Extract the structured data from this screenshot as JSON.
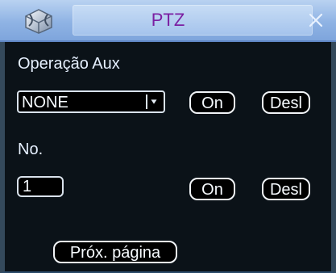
{
  "window": {
    "title": "PTZ",
    "logo_icon": "cube-logo-icon",
    "close_icon": "close-icon"
  },
  "aux": {
    "label": "Operação Aux",
    "select_value": "NONE",
    "on_label": "On",
    "off_label": "Desl"
  },
  "number": {
    "label": "No.",
    "value": "1",
    "on_label": "On",
    "off_label": "Desl"
  },
  "next_page_label": "Próx. página",
  "colors": {
    "title_text": "#7b1fa2",
    "title_bar": "#8fb3e4",
    "panel_bg": "#0b1218",
    "text": "#e6f0ff"
  }
}
